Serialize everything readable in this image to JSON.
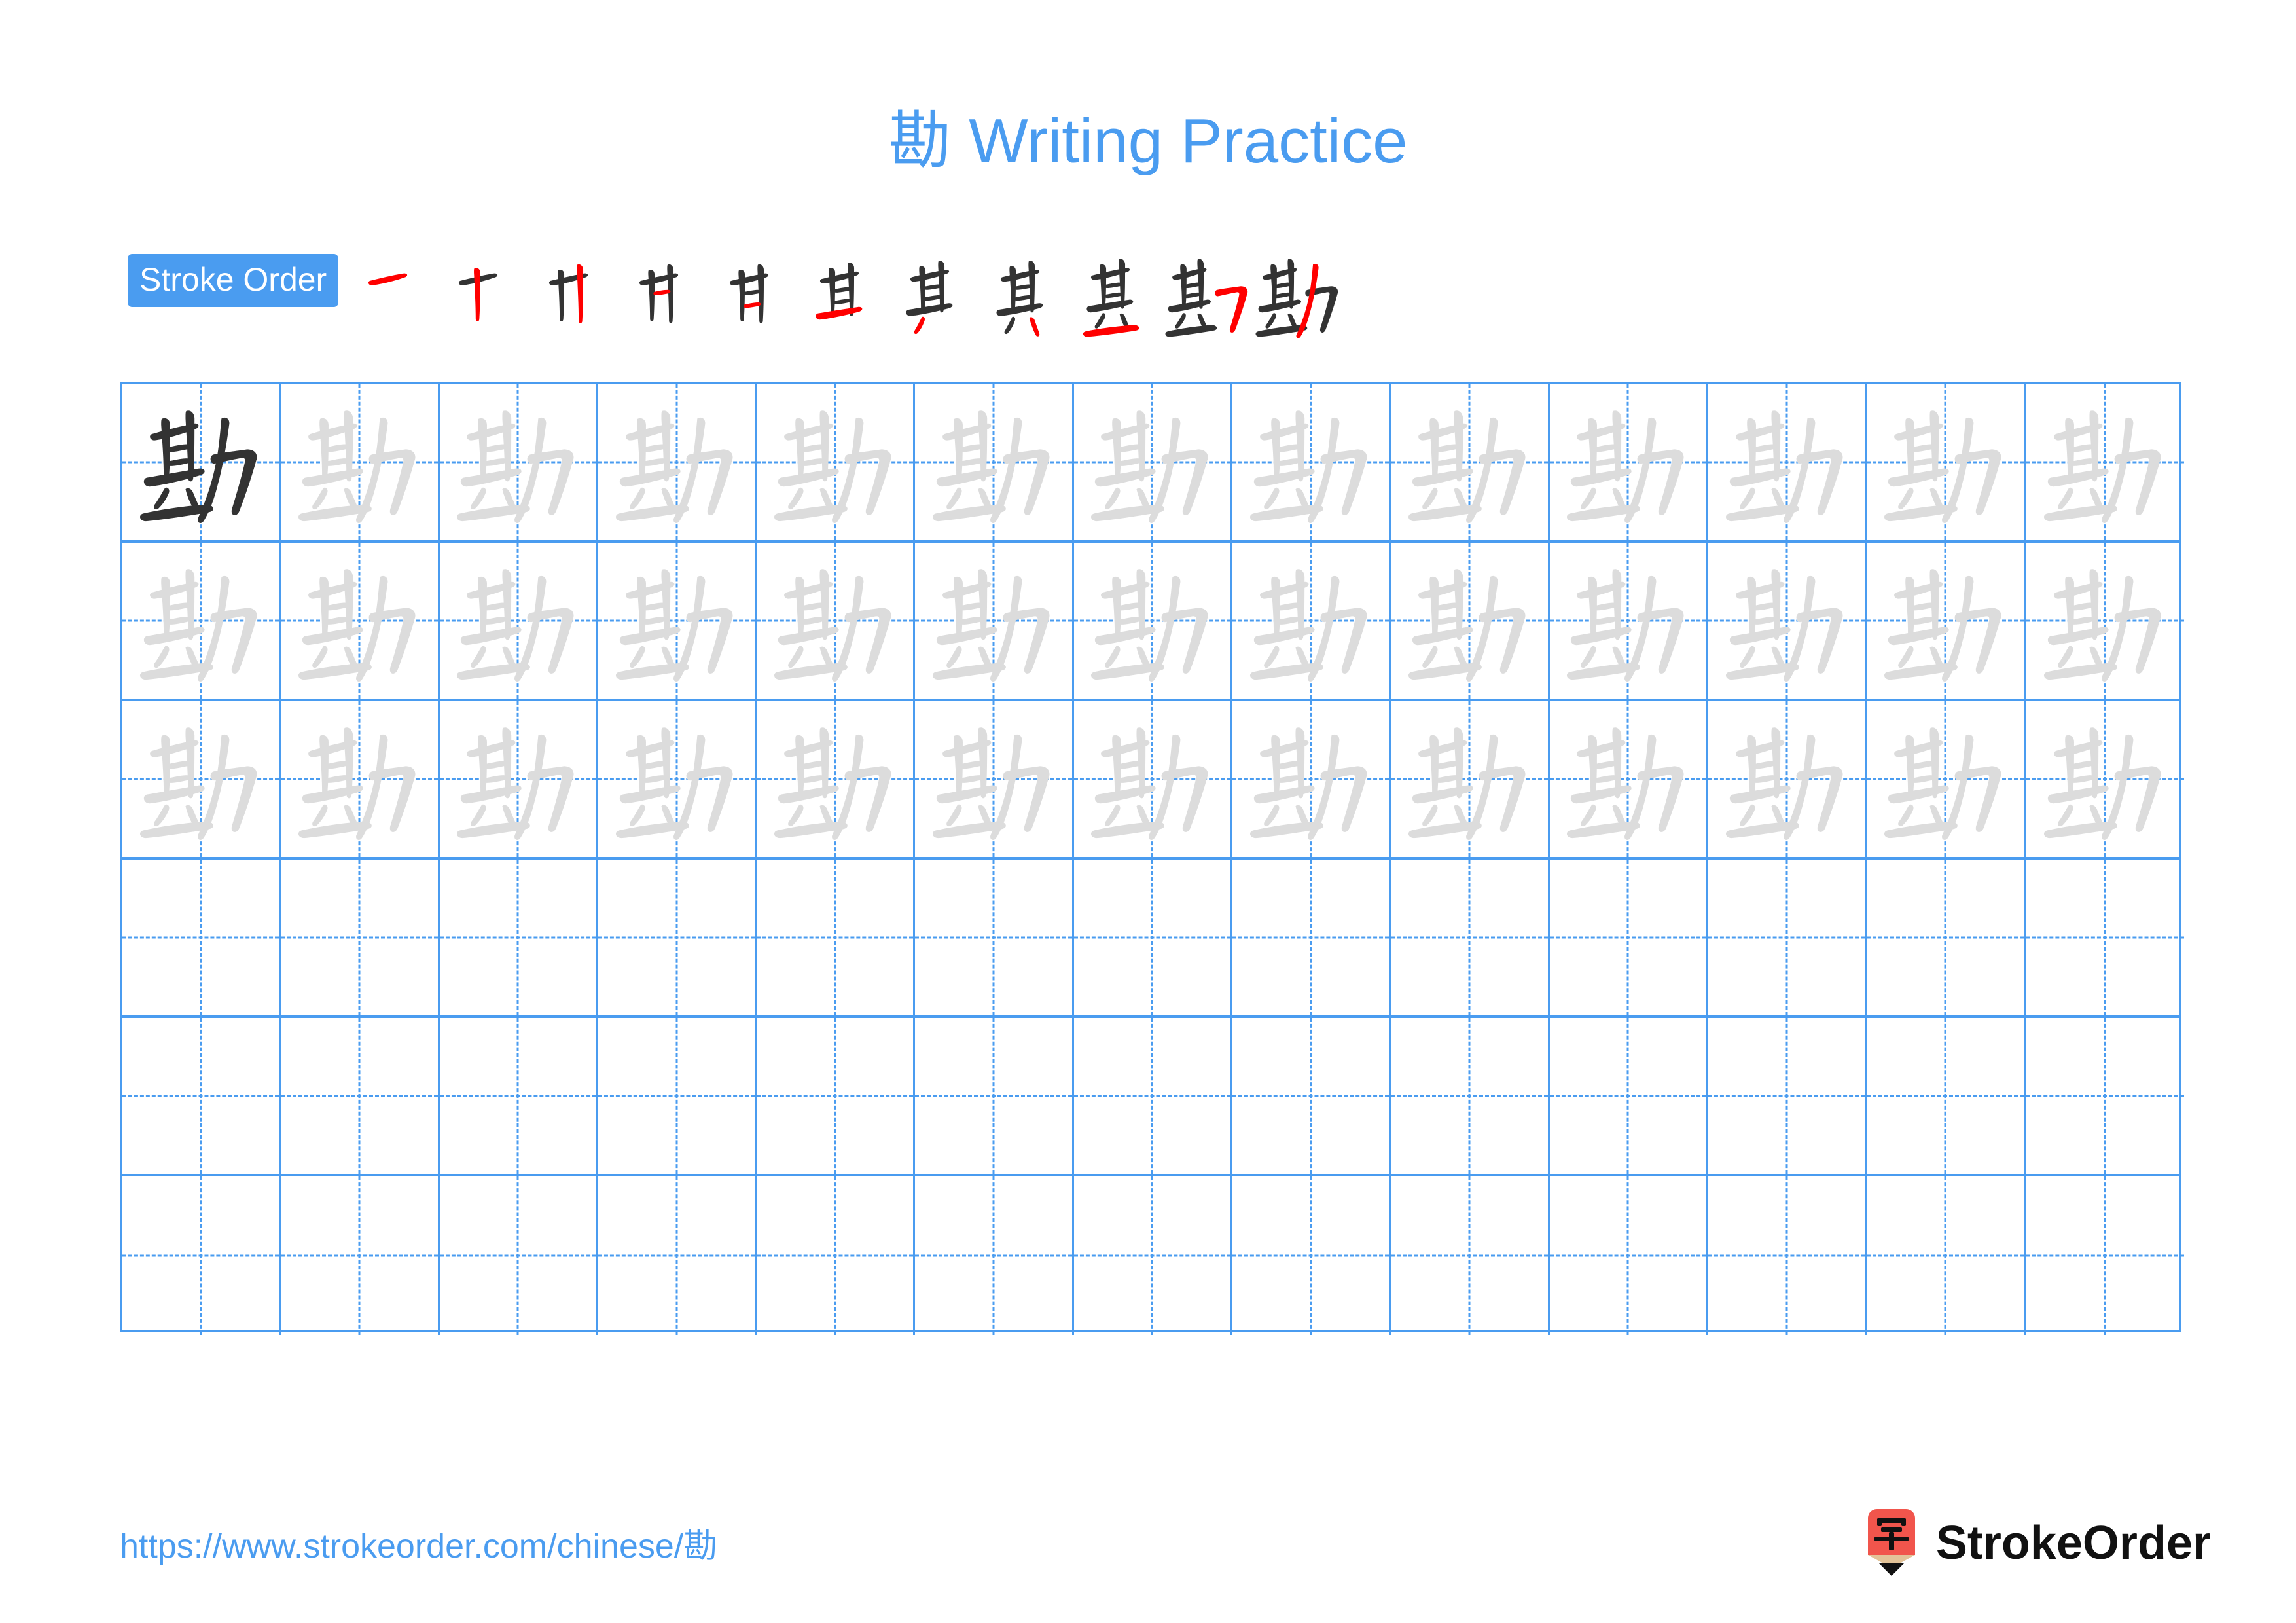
{
  "page": {
    "character": "勘",
    "title": "勘 Writing Practice",
    "background_color": "#ffffff",
    "accent_color": "#4a9cf0",
    "stroke_new_color": "#ff0000",
    "stroke_old_color": "#333333",
    "trace_color": "#dcdcdc"
  },
  "stroke_order": {
    "badge_label": "Stroke Order",
    "total_strokes": 11,
    "steps": [
      {
        "index": 1,
        "partial": "一"
      },
      {
        "index": 2,
        "partial": "十"
      },
      {
        "index": 3,
        "partial": "卄"
      },
      {
        "index": 4,
        "partial": "廿"
      },
      {
        "index": 5,
        "partial": "甘"
      },
      {
        "index": 6,
        "partial": "甚"
      },
      {
        "index": 7,
        "partial": "其"
      },
      {
        "index": 8,
        "partial": "其"
      },
      {
        "index": 9,
        "partial": "甚"
      },
      {
        "index": 10,
        "partial": "勘"
      },
      {
        "index": 11,
        "partial": "勘"
      }
    ]
  },
  "practice_grid": {
    "columns": 13,
    "rows": 6,
    "rows_data": [
      {
        "row": 1,
        "cells": [
          "model",
          "trace",
          "trace",
          "trace",
          "trace",
          "trace",
          "trace",
          "trace",
          "trace",
          "trace",
          "trace",
          "trace",
          "trace"
        ]
      },
      {
        "row": 2,
        "cells": [
          "trace",
          "trace",
          "trace",
          "trace",
          "trace",
          "trace",
          "trace",
          "trace",
          "trace",
          "trace",
          "trace",
          "trace",
          "trace"
        ]
      },
      {
        "row": 3,
        "cells": [
          "trace",
          "trace",
          "trace",
          "trace",
          "trace",
          "trace",
          "trace",
          "trace",
          "trace",
          "trace",
          "trace",
          "trace",
          "trace"
        ]
      },
      {
        "row": 4,
        "cells": [
          "empty",
          "empty",
          "empty",
          "empty",
          "empty",
          "empty",
          "empty",
          "empty",
          "empty",
          "empty",
          "empty",
          "empty",
          "empty"
        ]
      },
      {
        "row": 5,
        "cells": [
          "empty",
          "empty",
          "empty",
          "empty",
          "empty",
          "empty",
          "empty",
          "empty",
          "empty",
          "empty",
          "empty",
          "empty",
          "empty"
        ]
      },
      {
        "row": 6,
        "cells": [
          "empty",
          "empty",
          "empty",
          "empty",
          "empty",
          "empty",
          "empty",
          "empty",
          "empty",
          "empty",
          "empty",
          "empty",
          "empty"
        ]
      }
    ]
  },
  "footer": {
    "url": "https://www.strokeorder.com/chinese/勘",
    "brand_name": "StrokeOrder",
    "brand_mark_character": "字",
    "brand_mark_color": "#f1554c",
    "brand_mark_wood_color": "#e3c398"
  }
}
